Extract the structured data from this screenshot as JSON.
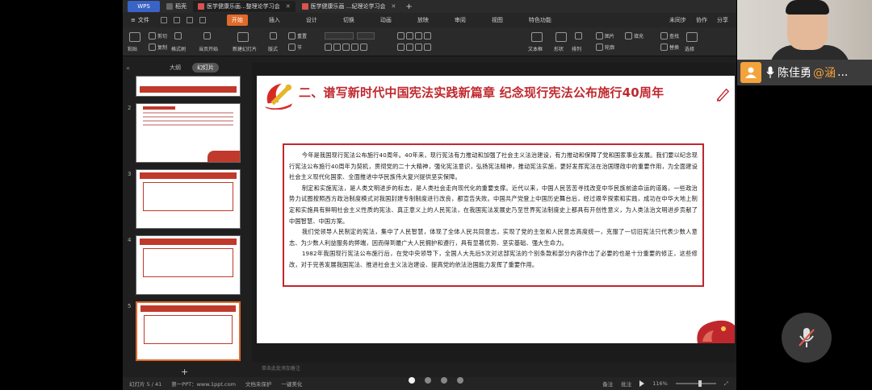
{
  "tabbar": {
    "wps": "WPS",
    "tabs": [
      {
        "label": "稻壳",
        "icon": "home-icon",
        "active": false
      },
      {
        "label": "医学健康乐画...整理论学习会",
        "icon": "ppt-icon",
        "active": true
      },
      {
        "label": "医学健康乐画 ...紀理论学习会",
        "icon": "ppt-icon",
        "active": false
      }
    ]
  },
  "menubar": {
    "file": "文件",
    "items": [
      "开始",
      "插入",
      "设计",
      "切换",
      "动画",
      "放映",
      "审阅",
      "视图",
      "特色功能"
    ],
    "active": "开始",
    "right": [
      "未同步",
      "协作",
      "分享"
    ]
  },
  "ribbon": {
    "paste": "粘贴",
    "cut": "剪切",
    "copy": "复制",
    "format_painter": "格式刷",
    "from_current": "当页开始",
    "new_slide": "新建幻灯片",
    "layout": "版式",
    "section": "节",
    "reset": "重置",
    "textbox": "文本框",
    "shape": "形状",
    "arrange": "排列",
    "picture": "图片",
    "fill": "填充",
    "outline": "轮廓",
    "find": "查找",
    "replace": "替换",
    "select": "选择"
  },
  "viewtabs": {
    "outline": "大纲",
    "slides": "幻灯片",
    "active": "幻灯片"
  },
  "thumbnails": [
    {
      "num": "",
      "selected": false
    },
    {
      "num": "2",
      "selected": false
    },
    {
      "num": "3",
      "selected": false
    },
    {
      "num": "4",
      "selected": false
    },
    {
      "num": "5",
      "selected": true
    }
  ],
  "slide": {
    "title": "二、谱写新时代中国宪法实践新篇章 纪念现行宪法公布施行40周年",
    "paragraphs": [
      "今年是我国现行宪法公布施行40周年。40年来，现行宪法有力推动和加强了社会主义法治建设，有力推动和保障了党和国家事业发展。我们要以纪念现行宪法公布施行40周年为契机，贯彻党的二十大精神，强化宪法意识，弘扬宪法精神，推动宪法实施，更好发挥宪法在治国理政中的重要作用，为全面建设社会主义现代化国家、全面推进中华民族伟大复兴提供坚实保障。",
      "制定和实施宪法，是人类文明进步的标志，是人类社会走向现代化的重要支撑。近代以来，中国人民苦苦寻找改变中华民族前途命运的道路，一些政治势力试图按照西方政治制度模式对我国封建专制制度进行改良，都宣告失败。中国共产党登上中国历史舞台后，经过艰辛探索和实践，成功在中华大地上制定和实施具有鲜明社会主义性质的宪法、真正意义上的人民宪法，在我国宪法发展史乃至世界宪法制度史上都具有开创性意义，为人类法治文明进步贡献了中国智慧、中国方案。",
      "我们党领导人民制定的宪法，集中了人民智慧，体现了全体人民共同意志，实现了党的主张和人民意志高度统一，克服了一切旧宪法只代表少数人意志、为少数人利益服务的弊端，因而得到最广大人民拥护和遵行，具有显著优势、坚实基础、强大生命力。",
      "1982年我国现行宪法公布施行后，在党中央领导下，全国人大先后5次对这部宪法的个别条款和部分内容作出了必要的也是十分重要的修正，这些修改，对于完善发展我国宪法、推进社会主义法治建设、提高党的依法治国能力发挥了重要作用。"
    ]
  },
  "notes": {
    "placeholder": "单击此处添加备注"
  },
  "statusbar": {
    "slide_count": "幻灯片 5 / 41",
    "template": "第一PPT：www.1ppt.com",
    "doc_check": "文档未保护",
    "beautify": "一键美化",
    "notes": "备注",
    "comment": "批注",
    "zoom": "116%"
  },
  "pager": {
    "total": 4,
    "current": 1
  },
  "call": {
    "speaker_name": "陈佳勇",
    "speaker_tag": "@涵",
    "more": "...",
    "avatar_icon": "user-icon",
    "mic_icon": "microphone-icon",
    "mute_icon": "microphone-muted-icon"
  },
  "colors": {
    "accent": "#e06a2a",
    "slide_red": "#c0272d",
    "avatar": "#f4a23b"
  }
}
